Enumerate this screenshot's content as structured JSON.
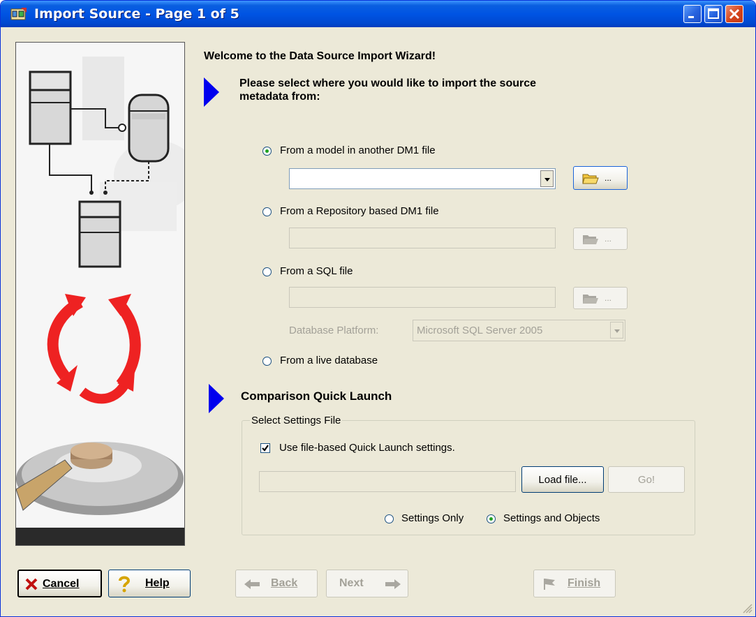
{
  "window": {
    "title": "Import Source - Page 1 of 5"
  },
  "header": {
    "welcome": "Welcome to the Data Source Import Wizard!",
    "instruction_line1": "Please select where you would like to import the source",
    "instruction_line2": "metadata from:"
  },
  "sources": {
    "model_file": {
      "label": "From a model in another DM1 file",
      "selected": true,
      "value": ""
    },
    "repo_file": {
      "label": "From a Repository based DM1 file",
      "selected": false,
      "value": ""
    },
    "sql_file": {
      "label": "From a SQL file",
      "selected": false,
      "value": ""
    },
    "platform_label": "Database Platform:",
    "platform_value": "Microsoft SQL Server 2005",
    "live_db": {
      "label": "From a live database",
      "selected": false
    },
    "browse_caption": "..."
  },
  "quick_launch": {
    "heading": "Comparison Quick Launch",
    "group_title": "Select Settings File",
    "use_file_label": "Use file-based Quick Launch settings.",
    "use_file_checked": true,
    "file_value": "",
    "load_button": "Load file...",
    "go_button": "Go!",
    "settings_only": "Settings Only",
    "settings_and_objects": "Settings and Objects",
    "selected_option": "Settings and Objects"
  },
  "footer": {
    "cancel": "Cancel",
    "help": "Help",
    "back": "Back",
    "next": "Next",
    "finish": "Finish"
  }
}
